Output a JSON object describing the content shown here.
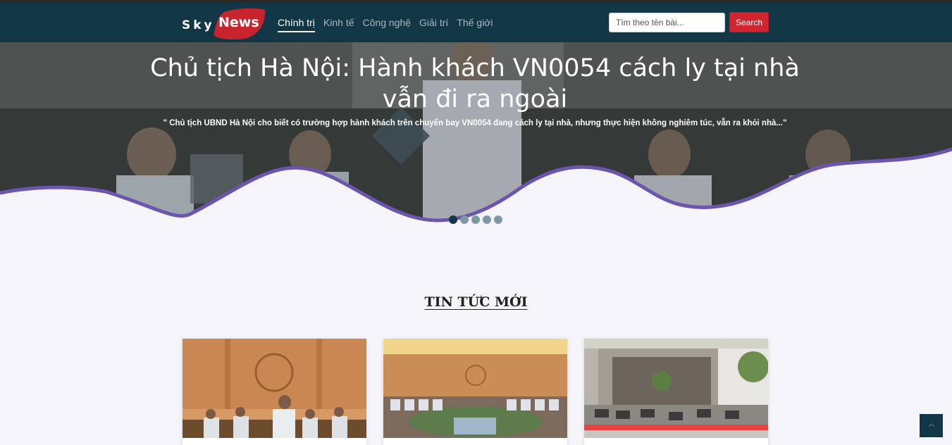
{
  "brand": {
    "part1": "Sky",
    "part2": "News"
  },
  "nav": {
    "items": [
      {
        "label": "Chính trị",
        "active": true
      },
      {
        "label": "Kinh tế",
        "active": false
      },
      {
        "label": "Công nghệ",
        "active": false
      },
      {
        "label": "Giải trí",
        "active": false
      },
      {
        "label": "Thế giới",
        "active": false
      }
    ]
  },
  "search": {
    "placeholder": "Tìm theo tên bài...",
    "button_label": "Search"
  },
  "hero": {
    "headline_line1": "Chủ tịch Hà Nội: Hành khách VN0054 cách ly tại nhà",
    "headline_line2": "vẫn đi ra ngoài",
    "summary": "\" Chủ tịch UBND Hà Nội cho biết có trường hợp hành khách trên chuyến bay VN0054 đang cách ly tại nhà, nhưng thực hiện không nghiêm túc, vẫn ra khỏi nhà...\"",
    "slide_count": 5,
    "active_slide": 1
  },
  "section": {
    "title": "TIN TỨC MỚI"
  },
  "colors": {
    "navbar": "#113746",
    "brand_accent": "#c8242d",
    "search_button": "#d0252f",
    "wave_stroke": "#6b55b0",
    "page_background": "#f5f4f8"
  },
  "icons": {
    "back_to_top": "chevron-up-icon"
  }
}
